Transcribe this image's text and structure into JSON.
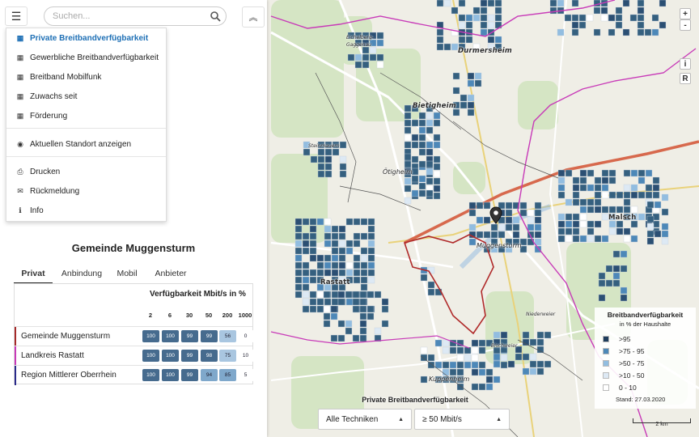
{
  "search": {
    "placeholder": "Suchen..."
  },
  "menu": {
    "items": [
      {
        "label": "Private Breitbandverfügbarkeit",
        "icon": "map-icon",
        "active": true
      },
      {
        "label": "Gewerbliche Breitbandverfügbarkeit",
        "icon": "map-icon"
      },
      {
        "label": "Breitband Mobilfunk",
        "icon": "map-icon"
      },
      {
        "label": "Zuwachs seit",
        "icon": "map-icon"
      },
      {
        "label": "Förderung",
        "icon": "map-icon"
      },
      {
        "label": "Aktuellen Standort anzeigen",
        "icon": "compass-icon"
      },
      {
        "label": "Drucken",
        "icon": "print-icon"
      },
      {
        "label": "Rückmeldung",
        "icon": "envelope-icon"
      },
      {
        "label": "Info",
        "icon": "info-icon"
      }
    ]
  },
  "region": {
    "title": "Gemeinde Muggensturm"
  },
  "tabs": [
    "Privat",
    "Anbindung",
    "Mobil",
    "Anbieter"
  ],
  "table": {
    "header": "Verfügbarkeit Mbit/s in %",
    "columns": [
      "2",
      "6",
      "30",
      "50",
      "200",
      "1000"
    ],
    "rows": [
      {
        "name": "Gemeinde Muggensturm",
        "color": "#a52a2a",
        "values": [
          "100",
          "100",
          "99",
          "99",
          "56",
          "0"
        ]
      },
      {
        "name": "Landkreis Rastatt",
        "color": "#c83ab8",
        "values": [
          "100",
          "100",
          "99",
          "98",
          "75",
          "10"
        ]
      },
      {
        "name": "Region Mittlerer Oberrhein",
        "color": "#2a2a8a",
        "values": [
          "100",
          "100",
          "99",
          "94",
          "85",
          "5"
        ]
      }
    ]
  },
  "legend": {
    "title": "Breitbandverfügbarkeit",
    "subtitle": "in % der Haushalte",
    "items": [
      {
        "label": ">95",
        "color": "#1f3d5c"
      },
      {
        "label": ">75 - 95",
        "color": "#4d88b8"
      },
      {
        "label": ">50 - 75",
        "color": "#92bde0"
      },
      {
        "label": ">10 - 50",
        "color": "#dde9f4"
      },
      {
        "label": "0 - 10",
        "color": "#ffffff"
      }
    ],
    "stand": "Stand: 27.03.2020"
  },
  "map": {
    "controls": {
      "zoom_in": "+",
      "zoom_out": "-",
      "info": "i",
      "reset": "R"
    },
    "layer_title": "Private Breitbandverfügbarkeit",
    "technology": "Alle Techniken",
    "speed": "≥ 50 Mbit/s",
    "scale": "2 km",
    "labels": [
      {
        "text": "Eichelberg-",
        "cls": "small"
      },
      {
        "text": "Gaggenau",
        "cls": "small"
      },
      {
        "text": "Durmersheim",
        "cls": "town"
      },
      {
        "text": "Bietigheim",
        "cls": "town"
      },
      {
        "text": "Steinmauern",
        "cls": "small"
      },
      {
        "text": "Ötigheim",
        "cls": ""
      },
      {
        "text": "Rastatt",
        "cls": "town"
      },
      {
        "text": "Muggensturm",
        "cls": ""
      },
      {
        "text": "Malsch",
        "cls": "town"
      },
      {
        "text": "Niederweier",
        "cls": "small"
      },
      {
        "text": "Bischweier",
        "cls": "small"
      },
      {
        "text": "Kuppenheim",
        "cls": ""
      }
    ]
  }
}
